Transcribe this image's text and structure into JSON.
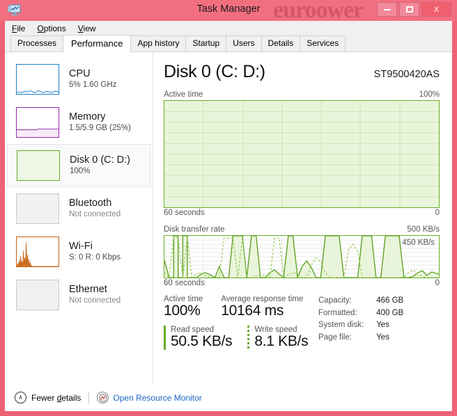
{
  "window": {
    "title": "Task Manager",
    "watermark": "euroower",
    "app_icon": "task-manager-monitor-icon",
    "minimize_label": "Minimize",
    "maximize_label": "Maximize",
    "close_label": "X"
  },
  "menu": [
    {
      "label": "File",
      "accel": "F"
    },
    {
      "label": "Options",
      "accel": "O"
    },
    {
      "label": "View",
      "accel": "V"
    }
  ],
  "tabs": [
    {
      "label": "Processes",
      "active": false
    },
    {
      "label": "Performance",
      "active": true
    },
    {
      "label": "App history",
      "active": false
    },
    {
      "label": "Startup",
      "active": false
    },
    {
      "label": "Users",
      "active": false
    },
    {
      "label": "Details",
      "active": false
    },
    {
      "label": "Services",
      "active": false
    }
  ],
  "sidebar": {
    "items": [
      {
        "title": "CPU",
        "sub": "5% 1.60 GHz",
        "color": "#1a7fc1",
        "selected": false,
        "connected": true
      },
      {
        "title": "Memory",
        "sub": "1.5/5.9 GB (25%)",
        "color": "#9b27af",
        "selected": false,
        "connected": true
      },
      {
        "title": "Disk 0 (C: D:)",
        "sub": "100%",
        "color": "#6aa829",
        "selected": true,
        "connected": true
      },
      {
        "title": "Bluetooth",
        "sub": "Not connected",
        "color": "#b0b0b0",
        "selected": false,
        "connected": false
      },
      {
        "title": "Wi-Fi",
        "sub": "S: 0 R: 0 Kbps",
        "color": "#c25e10",
        "selected": false,
        "connected": true
      },
      {
        "title": "Ethernet",
        "sub": "Not connected",
        "color": "#b0b0b0",
        "selected": false,
        "connected": false
      }
    ]
  },
  "main": {
    "title": "Disk 0 (C: D:)",
    "model": "ST9500420AS",
    "active_graph": {
      "label": "Active time",
      "max_label": "100%",
      "left_foot": "60 seconds",
      "right_foot": "0"
    },
    "transfer_graph": {
      "label": "Disk transfer rate",
      "max_label": "500 KB/s",
      "inner_label": "450 KB/s",
      "left_foot": "60 seconds",
      "right_foot": "0"
    },
    "stats": {
      "active_time_caption": "Active time",
      "active_time_value": "100%",
      "response_caption": "Average response time",
      "response_value": "10164 ms",
      "read_caption": "Read speed",
      "read_value": "50.5 KB/s",
      "write_caption": "Write speed",
      "write_value": "8.1 KB/s"
    },
    "meta": [
      {
        "key": "Capacity:",
        "value": "466 GB"
      },
      {
        "key": "Formatted:",
        "value": "400 GB"
      },
      {
        "key": "System disk:",
        "value": "Yes"
      },
      {
        "key": "Page file:",
        "value": "Yes"
      }
    ]
  },
  "statusbar": {
    "chevron": "∧",
    "fewer_details": "Fewer details",
    "resource_monitor": "Open Resource Monitor",
    "resource_icon": "resource-monitor-icon"
  },
  "chart_data": [
    {
      "type": "area",
      "name": "active-time",
      "title": "Active time",
      "ylim": [
        0,
        100
      ],
      "ylabel": "%",
      "xlabel": "60 seconds",
      "grid": true,
      "fill_color": "#dff0c8",
      "line_color": "#6aa829",
      "values": [
        100,
        100,
        100,
        100,
        100,
        100,
        100,
        100,
        100,
        100,
        100,
        100,
        100,
        100,
        100,
        100,
        100,
        100,
        100,
        100,
        100,
        100,
        100,
        100,
        100,
        100,
        100,
        100,
        100,
        100,
        100,
        100,
        100,
        100,
        100,
        100,
        100,
        100,
        100,
        100,
        100,
        100,
        100,
        100,
        100,
        100,
        100,
        100,
        100,
        100,
        100,
        100,
        100,
        100,
        100,
        100,
        100,
        100,
        100,
        100
      ]
    },
    {
      "type": "area",
      "name": "disk-transfer-rate",
      "title": "Disk transfer rate",
      "ylim": [
        0,
        500
      ],
      "ylabel": "KB/s",
      "xlabel": "60 seconds",
      "grid": true,
      "annotation": "450 KB/s",
      "series": [
        {
          "name": "read",
          "style": "solid",
          "color": "#6aa829",
          "values": [
            210,
            0,
            500,
            500,
            500,
            0,
            0,
            0,
            40,
            55,
            30,
            0,
            130,
            0,
            0,
            500,
            500,
            500,
            0,
            500,
            500,
            0,
            0,
            60,
            90,
            40,
            0,
            500,
            500,
            0,
            130,
            200,
            120,
            0,
            0,
            500,
            500,
            500,
            500,
            0,
            0,
            0,
            0,
            0,
            500,
            500,
            500,
            0,
            0,
            500,
            500,
            500,
            500,
            0,
            0,
            20,
            60,
            80,
            30,
            70
          ]
        },
        {
          "name": "write",
          "style": "dashed",
          "color": "#8cc63f",
          "values": [
            60,
            0,
            480,
            480,
            480,
            0,
            0,
            40,
            75,
            60,
            20,
            0,
            0,
            0,
            0,
            470,
            470,
            470,
            0,
            470,
            0,
            0,
            0,
            20,
            35,
            25,
            0,
            470,
            470,
            0,
            30,
            60,
            40,
            0,
            0,
            160,
            230,
            190,
            60,
            0,
            0,
            0,
            0,
            0,
            330,
            400,
            320,
            0,
            0,
            0,
            0,
            0,
            0,
            0,
            0,
            10,
            55,
            95,
            35,
            20
          ]
        }
      ]
    },
    {
      "type": "line",
      "name": "cpu-thumbnail",
      "title": "CPU",
      "ylim": [
        0,
        100
      ],
      "line_color": "#1a7fc1",
      "values": [
        2,
        3,
        2,
        4,
        3,
        5,
        4,
        3,
        6,
        4,
        3,
        5,
        4,
        6,
        5,
        3,
        4,
        5,
        3,
        4,
        6,
        5,
        4,
        3,
        5,
        4,
        3,
        5,
        4,
        3
      ]
    },
    {
      "type": "area",
      "name": "memory-thumbnail",
      "title": "Memory",
      "ylim": [
        0,
        100
      ],
      "line_color": "#9b27af",
      "fill_color": "#f7eaf9",
      "values": [
        25,
        25,
        25,
        25,
        25,
        25,
        25,
        25,
        25,
        25,
        25,
        25,
        25,
        25,
        25,
        26,
        26,
        26,
        26,
        26,
        26,
        26,
        26,
        26,
        26,
        26,
        26,
        26,
        26,
        26
      ]
    },
    {
      "type": "area",
      "name": "disk-thumbnail",
      "title": "Disk 0",
      "ylim": [
        0,
        100
      ],
      "line_color": "#6aa829",
      "fill_color": "#eef7e4",
      "values": [
        100,
        100,
        100,
        100,
        100,
        100,
        100,
        100,
        100,
        100,
        100,
        100,
        100,
        100,
        100,
        100,
        100,
        100,
        100,
        100,
        100,
        100,
        100,
        100,
        100,
        100,
        100,
        100,
        100,
        100
      ]
    },
    {
      "type": "area",
      "name": "wifi-thumbnail",
      "title": "Wi-Fi",
      "ylim": [
        0,
        100
      ],
      "line_color": "#c25e10",
      "fill_color": "#f3d9c2",
      "values": [
        12,
        30,
        18,
        45,
        22,
        60,
        35,
        20,
        82,
        40,
        95,
        30,
        15,
        8,
        5,
        3,
        2,
        1,
        0,
        0,
        0,
        0,
        0,
        0,
        0,
        0,
        0,
        0,
        0,
        0
      ]
    }
  ]
}
